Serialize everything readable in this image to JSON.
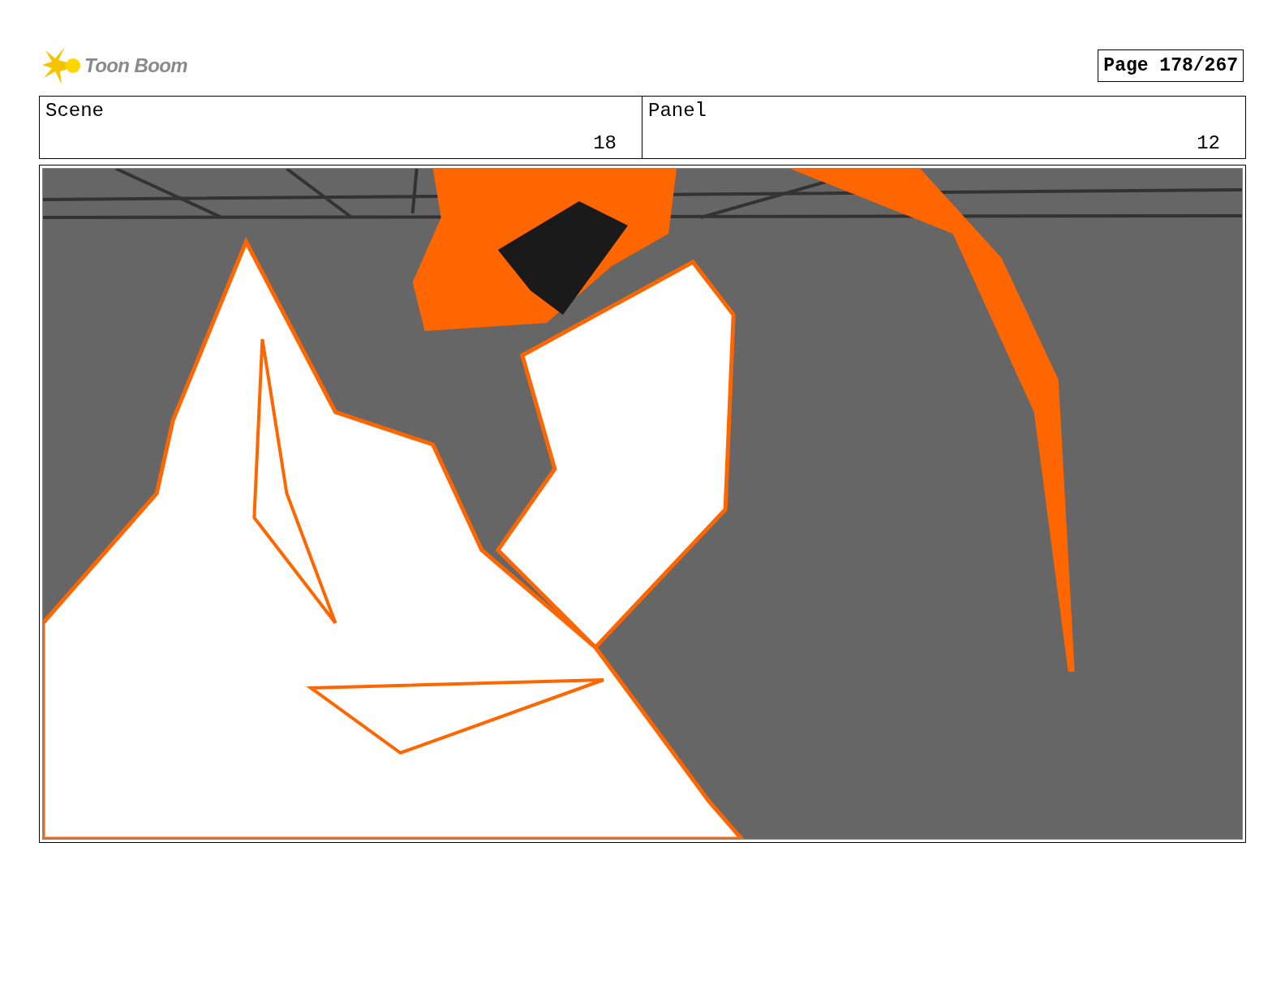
{
  "logo": {
    "text": "Toon Boom"
  },
  "page_label": "Page 178/267",
  "fields": [
    {
      "label": "Scene",
      "value": "18"
    },
    {
      "label": "Panel",
      "value": "12"
    }
  ]
}
